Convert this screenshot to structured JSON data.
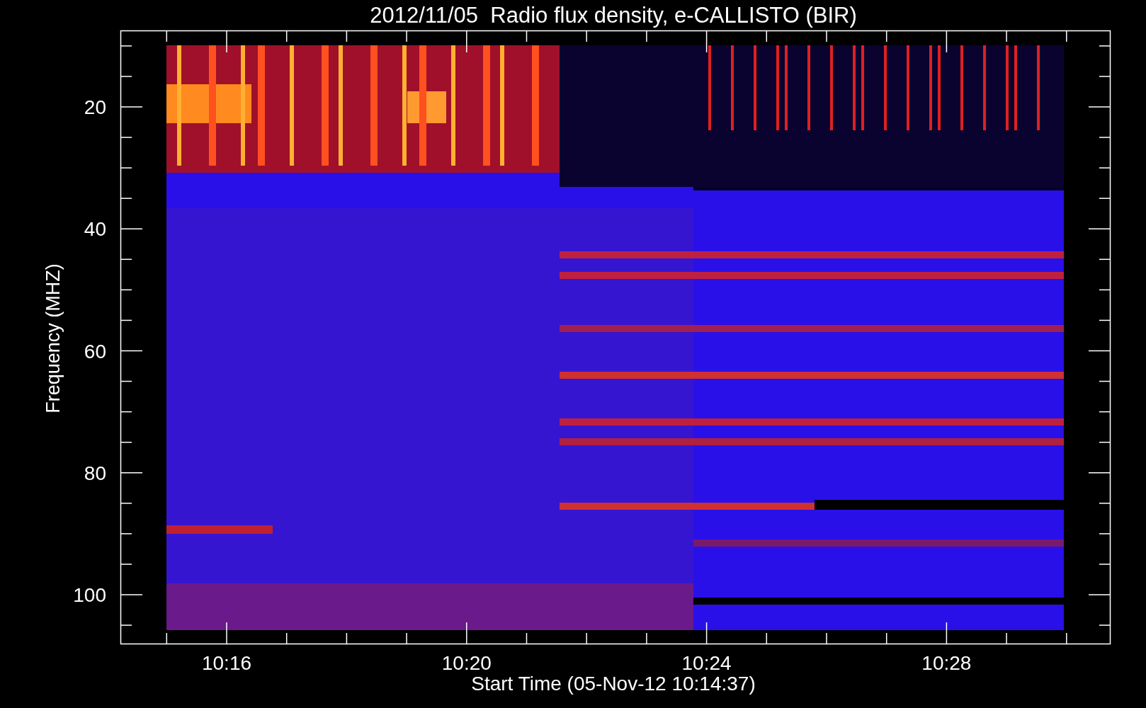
{
  "title": "2012/11/05  Radio flux density, e-CALLISTO (BIR)",
  "y_axis": {
    "label": "Frequency (MHZ)",
    "ticks": [
      "20",
      "40",
      "60",
      "80",
      "100"
    ]
  },
  "x_axis": {
    "label": "Start Time (05-Nov-12 10:14:37)",
    "ticks": [
      "10:16",
      "10:20",
      "10:24",
      "10:28"
    ]
  }
}
